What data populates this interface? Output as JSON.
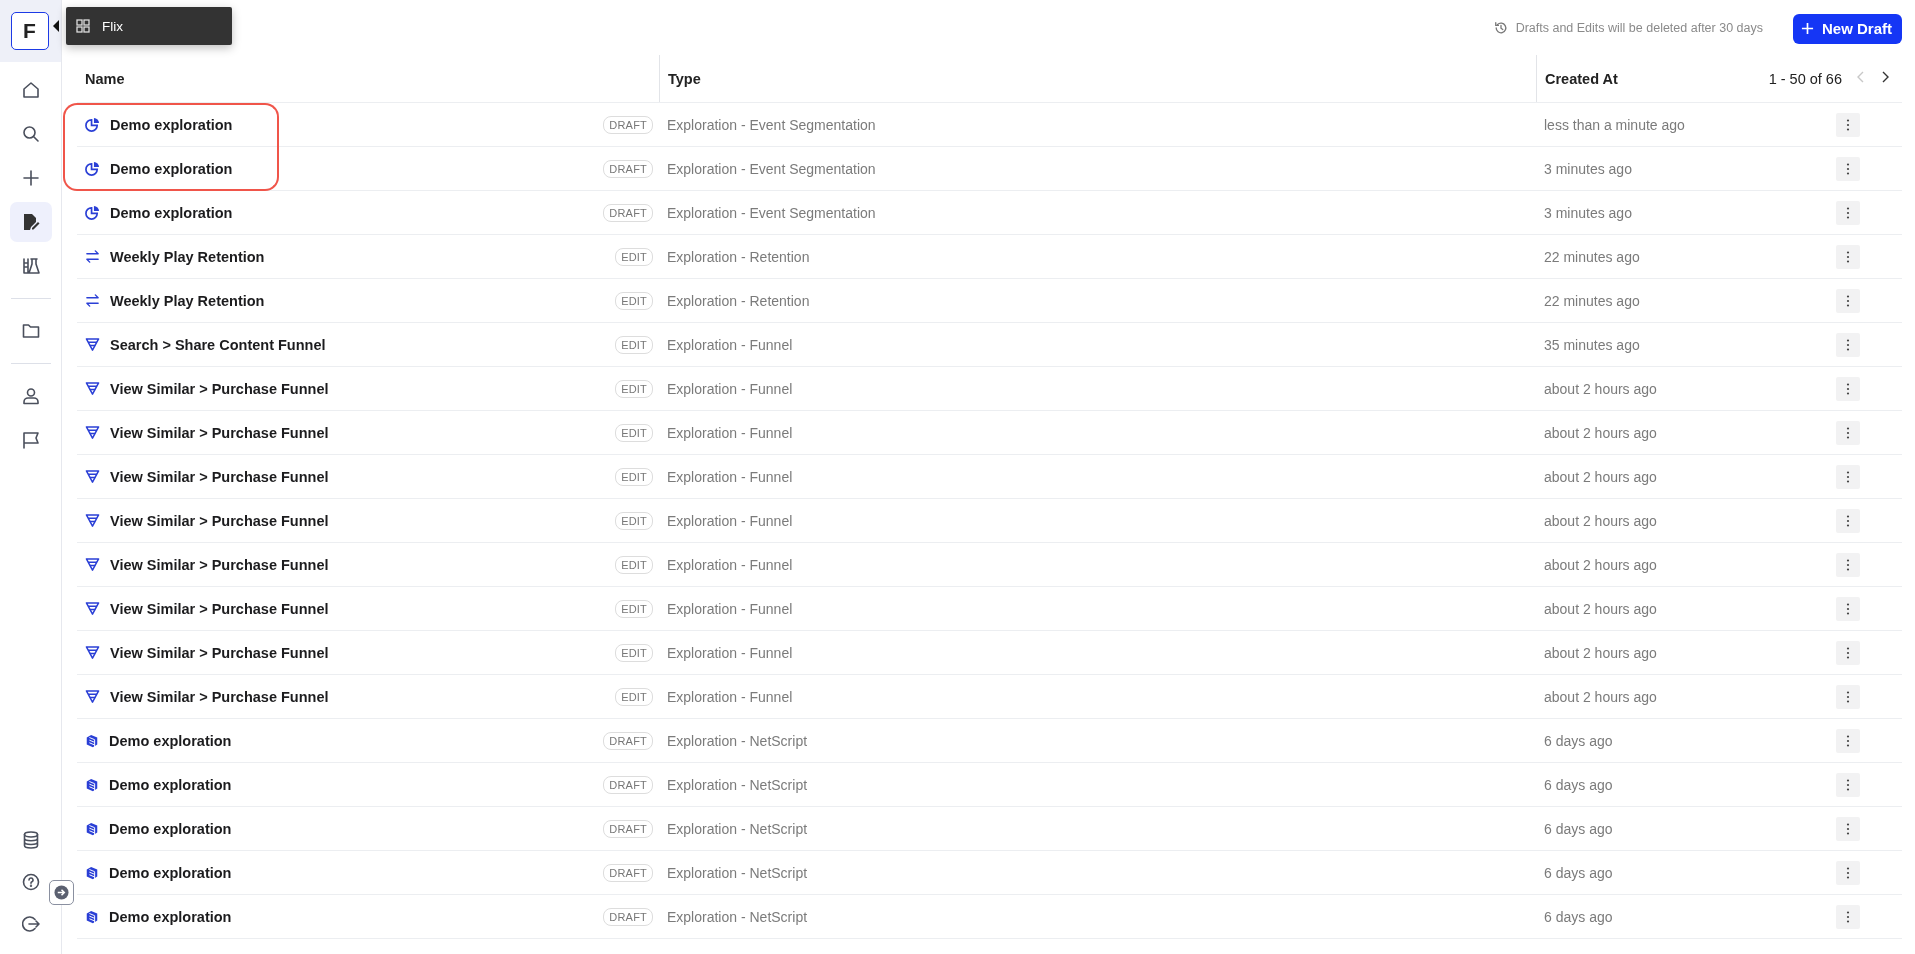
{
  "sidebar": {
    "logo": "F",
    "items": [
      {
        "selected": false
      },
      {
        "selected": false
      },
      {
        "selected": false
      },
      {
        "selected": true
      },
      {
        "selected": false
      },
      {
        "selected": false
      },
      {
        "selected": false
      },
      {
        "selected": false
      }
    ]
  },
  "tooltip": {
    "label": "Flix"
  },
  "header": {
    "notice": "Drafts and Edits will be deleted after 30 days",
    "new_button": "New Draft"
  },
  "table": {
    "columns": [
      "Name",
      "Type",
      "Created At"
    ],
    "pagination": {
      "range": "1 - 50 of 66",
      "prev_disabled": true,
      "next_disabled": false
    },
    "rows": [
      {
        "kind": "segmentation",
        "name": "Demo exploration",
        "badge": "DRAFT",
        "type": "Exploration - Event Segmentation",
        "created": "less than a minute ago",
        "highlighted": true
      },
      {
        "kind": "segmentation",
        "name": "Demo exploration",
        "badge": "DRAFT",
        "type": "Exploration - Event Segmentation",
        "created": "3 minutes ago",
        "highlighted": true
      },
      {
        "kind": "segmentation",
        "name": "Demo exploration",
        "badge": "DRAFT",
        "type": "Exploration - Event Segmentation",
        "created": "3 minutes ago",
        "highlighted": false
      },
      {
        "kind": "retention",
        "name": "Weekly Play Retention",
        "badge": "EDIT",
        "type": "Exploration - Retention",
        "created": "22 minutes ago",
        "highlighted": false
      },
      {
        "kind": "retention",
        "name": "Weekly Play Retention",
        "badge": "EDIT",
        "type": "Exploration - Retention",
        "created": "22 minutes ago",
        "highlighted": false
      },
      {
        "kind": "funnel",
        "name": "Search > Share Content Funnel",
        "badge": "EDIT",
        "type": "Exploration - Funnel",
        "created": "35 minutes ago",
        "highlighted": false
      },
      {
        "kind": "funnel",
        "name": "View Similar > Purchase Funnel",
        "badge": "EDIT",
        "type": "Exploration - Funnel",
        "created": "about 2 hours ago",
        "highlighted": false
      },
      {
        "kind": "funnel",
        "name": "View Similar > Purchase Funnel",
        "badge": "EDIT",
        "type": "Exploration - Funnel",
        "created": "about 2 hours ago",
        "highlighted": false
      },
      {
        "kind": "funnel",
        "name": "View Similar > Purchase Funnel",
        "badge": "EDIT",
        "type": "Exploration - Funnel",
        "created": "about 2 hours ago",
        "highlighted": false
      },
      {
        "kind": "funnel",
        "name": "View Similar > Purchase Funnel",
        "badge": "EDIT",
        "type": "Exploration - Funnel",
        "created": "about 2 hours ago",
        "highlighted": false
      },
      {
        "kind": "funnel",
        "name": "View Similar > Purchase Funnel",
        "badge": "EDIT",
        "type": "Exploration - Funnel",
        "created": "about 2 hours ago",
        "highlighted": false
      },
      {
        "kind": "funnel",
        "name": "View Similar > Purchase Funnel",
        "badge": "EDIT",
        "type": "Exploration - Funnel",
        "created": "about 2 hours ago",
        "highlighted": false
      },
      {
        "kind": "funnel",
        "name": "View Similar > Purchase Funnel",
        "badge": "EDIT",
        "type": "Exploration - Funnel",
        "created": "about 2 hours ago",
        "highlighted": false
      },
      {
        "kind": "funnel",
        "name": "View Similar > Purchase Funnel",
        "badge": "EDIT",
        "type": "Exploration - Funnel",
        "created": "about 2 hours ago",
        "highlighted": false
      },
      {
        "kind": "netscript",
        "name": "Demo exploration",
        "badge": "DRAFT",
        "type": "Exploration - NetScript",
        "created": "6 days ago",
        "highlighted": false
      },
      {
        "kind": "netscript",
        "name": "Demo exploration",
        "badge": "DRAFT",
        "type": "Exploration - NetScript",
        "created": "6 days ago",
        "highlighted": false
      },
      {
        "kind": "netscript",
        "name": "Demo exploration",
        "badge": "DRAFT",
        "type": "Exploration - NetScript",
        "created": "6 days ago",
        "highlighted": false
      },
      {
        "kind": "netscript",
        "name": "Demo exploration",
        "badge": "DRAFT",
        "type": "Exploration - NetScript",
        "created": "6 days ago",
        "highlighted": false
      },
      {
        "kind": "netscript",
        "name": "Demo exploration",
        "badge": "DRAFT",
        "type": "Exploration - NetScript",
        "created": "6 days ago",
        "highlighted": false
      }
    ]
  }
}
